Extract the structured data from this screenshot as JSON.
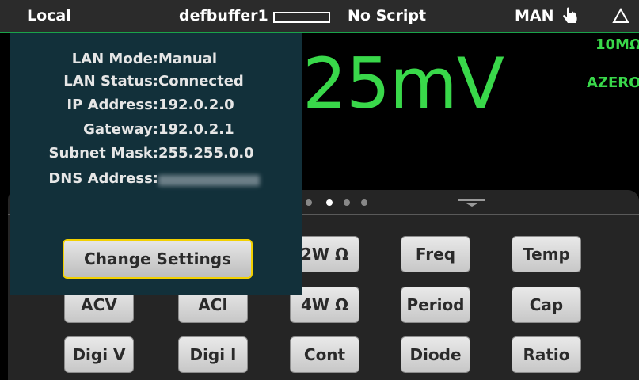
{
  "status_bar": {
    "mode": "Local",
    "buffer": "defbuffer1",
    "script": "No Script",
    "range_mode": "MAN",
    "hand_icon": "hand-pointer-icon",
    "warning_icon": "triangle-icon",
    "accent_color": "#1aa34a"
  },
  "reading": {
    "value": "25mV",
    "range": "10MΩ",
    "azero": "AZERO",
    "color": "#39d84a"
  },
  "swipe": {
    "page_dots": 4,
    "active_dot": 1
  },
  "functions": [
    {
      "label": "2W Ω"
    },
    {
      "label": "Freq"
    },
    {
      "label": "Temp"
    },
    {
      "label": "ACV"
    },
    {
      "label": "ACI"
    },
    {
      "label": "4W Ω"
    },
    {
      "label": "Period"
    },
    {
      "label": "Cap"
    },
    {
      "label": "Digi V"
    },
    {
      "label": "Digi I"
    },
    {
      "label": "Cont"
    },
    {
      "label": "Diode"
    },
    {
      "label": "Ratio"
    }
  ],
  "lan_popup": {
    "rows": [
      {
        "label": "LAN Mode:",
        "value": "Manual"
      },
      {
        "label": "LAN Status:",
        "value": "Connected"
      },
      {
        "label": "IP Address:",
        "value": "192.0.2.0"
      },
      {
        "label": "Gateway:",
        "value": "192.0.2.1"
      },
      {
        "label": "Subnet Mask:",
        "value": "255.255.0.0"
      },
      {
        "label": "DNS Address:",
        "value": ""
      }
    ],
    "button_label": "Change Settings",
    "button_border_color": "#f2d000"
  }
}
